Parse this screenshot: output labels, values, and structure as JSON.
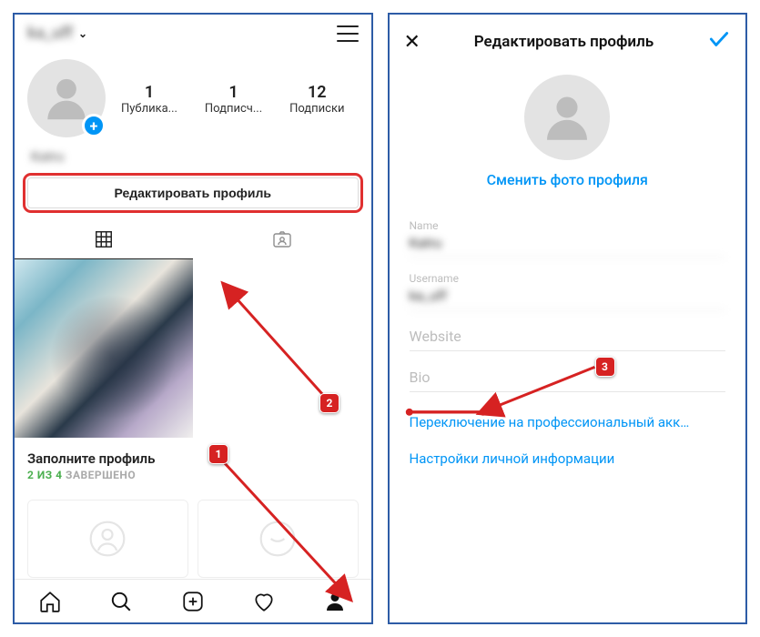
{
  "left": {
    "username": "ka_uff",
    "stats": {
      "posts": {
        "count": "1",
        "label": "Публика..."
      },
      "followers": {
        "count": "1",
        "label": "Подписч..."
      },
      "following": {
        "count": "12",
        "label": "Подписки"
      }
    },
    "display_name": "Katru",
    "edit_button": "Редактировать профиль",
    "complete": {
      "title": "Заполните профиль",
      "progress_done": "2 ИЗ 4",
      "progress_label": "ЗАВЕРШЕНО"
    },
    "annotations": {
      "badge1": "1",
      "badge2": "2"
    }
  },
  "right": {
    "title": "Редактировать профиль",
    "change_photo": "Сменить фото профиля",
    "fields": {
      "name_label": "Name",
      "name_value": "Katru",
      "username_label": "Username",
      "username_value": "ka_uff",
      "website_placeholder": "Website",
      "bio_placeholder": "Bio"
    },
    "links": {
      "pro": "Переключение на профессиональный акк…",
      "personal": "Настройки личной информации"
    },
    "annotations": {
      "badge3": "3"
    }
  }
}
